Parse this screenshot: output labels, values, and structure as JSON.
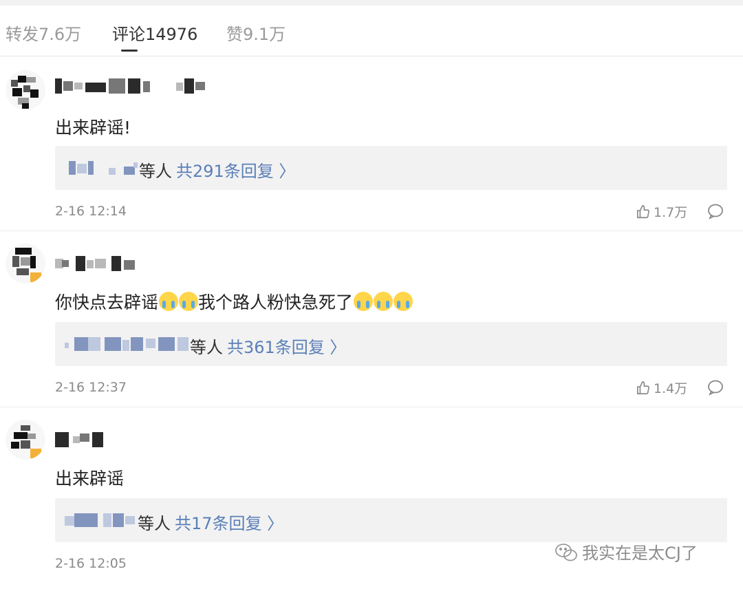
{
  "tabs": [
    {
      "label": "转发7.6万"
    },
    {
      "label": "评论14976"
    },
    {
      "label": "赞9.1万"
    }
  ],
  "comments": [
    {
      "text": "出来辟谣!",
      "reply_etc": "等人",
      "reply_count": "共291条回复 〉",
      "time": "2-16 12:14",
      "likes": "1.7万"
    },
    {
      "text_before": "你快点去辟谣",
      "text_after": "我个路人粉快急死了",
      "emoji_name": "crying-emoji",
      "reply_etc": "等人",
      "reply_count": "共361条回复 〉",
      "time": "2-16 12:37",
      "likes": "1.4万"
    },
    {
      "text": "出来辟谣",
      "reply_etc": "等人",
      "reply_count": "共17条回复 〉",
      "time": "2-16 12:05",
      "likes": ""
    }
  ],
  "watermark": {
    "text": "我实在是太CJ了",
    "icon": "wechat-icon"
  },
  "icons": {
    "like": "thumbs-up-icon",
    "comment": "speech-bubble-icon"
  },
  "colors": {
    "link_blue": "#5a7fb8",
    "muted_gray": "#8a8a8a",
    "reply_background": "#f2f2f2"
  }
}
